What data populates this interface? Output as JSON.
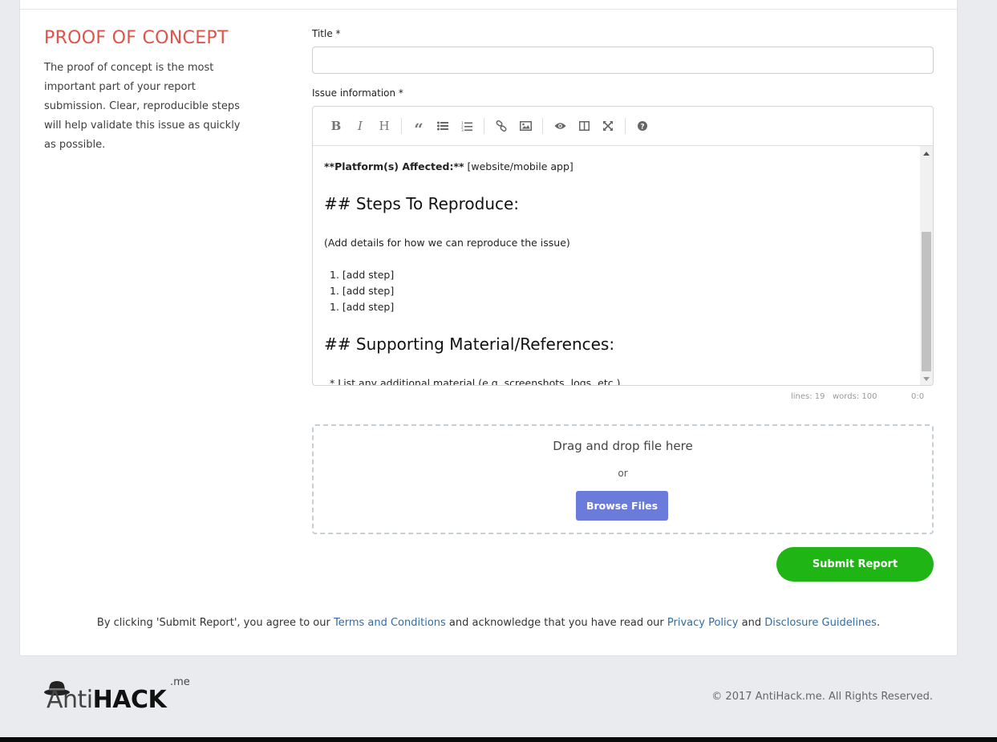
{
  "section": {
    "title": "PROOF OF CONCEPT",
    "description": "The proof of concept is the most important part of your report submission. Clear, reproducible steps will help validate this issue as quickly as possible."
  },
  "form": {
    "title_label": "Title *",
    "title_value": "",
    "issue_label": "Issue information *"
  },
  "toolbar": {
    "buttons": [
      "bold",
      "italic",
      "heading",
      "quote",
      "unordered-list",
      "ordered-list",
      "link",
      "image",
      "preview",
      "side-by-side",
      "fullscreen",
      "guide"
    ]
  },
  "editor": {
    "line_platform_bold": "**Platform(s) Affected:**",
    "line_platform_rest": " [website/mobile app]",
    "heading_steps": "## Steps To Reproduce:",
    "steps_intro": "(Add details for how we can reproduce the issue)",
    "steps": [
      "1. [add step]",
      "1. [add step]",
      "1. [add step]"
    ],
    "heading_supporting": "## Supporting Material/References:",
    "supporting_item": "* List any additional material (e.g. screenshots, logs, etc.)"
  },
  "status": {
    "lines": "lines: 19",
    "words": "words: 100",
    "cursor": "0:0"
  },
  "dropzone": {
    "title": "Drag and drop file here",
    "or": "or",
    "browse_label": "Browse Files"
  },
  "submit_label": "Submit Report",
  "agreement": {
    "prefix": "By clicking 'Submit Report', you agree to our ",
    "terms": "Terms and Conditions",
    "middle": " and acknowledge that you have read our ",
    "privacy": "Privacy Policy",
    "and": " and ",
    "disclosure": "Disclosure Guidelines",
    "suffix": "."
  },
  "footer": {
    "logo_anti": "Anti",
    "logo_hack": "HACK",
    "logo_me": ".me",
    "copyright": "© 2017 AntiHack.me. All Rights Reserved."
  },
  "colors": {
    "accent_title": "#e0524a",
    "browse_button": "#6a7bdc",
    "submit_button": "#1fb515",
    "link": "#2f6ca8"
  }
}
